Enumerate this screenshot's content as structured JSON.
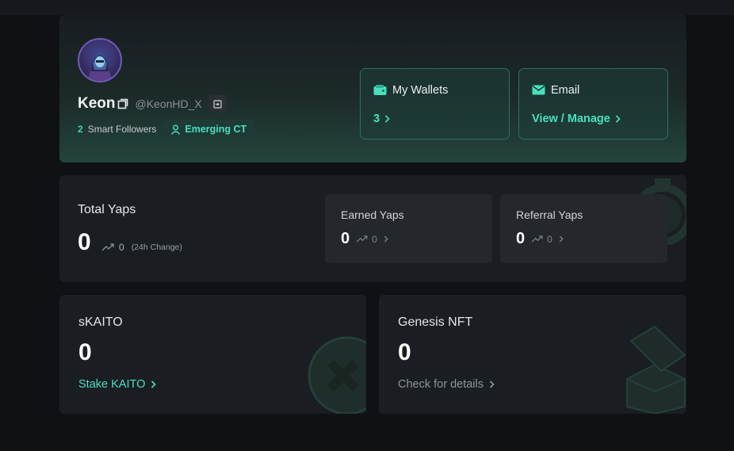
{
  "profile": {
    "name": "Keon",
    "handle": "@KeonHD_X",
    "smart_followers_count": "2",
    "smart_followers_label": "Smart Followers",
    "badge_label": "Emerging CT",
    "wallets": {
      "title": "My Wallets",
      "value": "3",
      "icon": "wallet-icon"
    },
    "email": {
      "title": "Email",
      "link": "View / Manage",
      "icon": "mail-icon"
    }
  },
  "yaps": {
    "title": "Total Yaps",
    "value": "0",
    "change": "0",
    "change_note": "(24h Change)",
    "earned": {
      "title": "Earned Yaps",
      "value": "0",
      "change": "0"
    },
    "referral": {
      "title": "Referral Yaps",
      "value": "0",
      "change": "0"
    }
  },
  "skaito": {
    "title": "sKAITO",
    "value": "0",
    "link": "Stake KAITO"
  },
  "genesis": {
    "title": "Genesis NFT",
    "value": "0",
    "link": "Check for details"
  },
  "colors": {
    "accent": "#47e0bf",
    "card": "#1a1d21",
    "background": "#0f1114"
  }
}
